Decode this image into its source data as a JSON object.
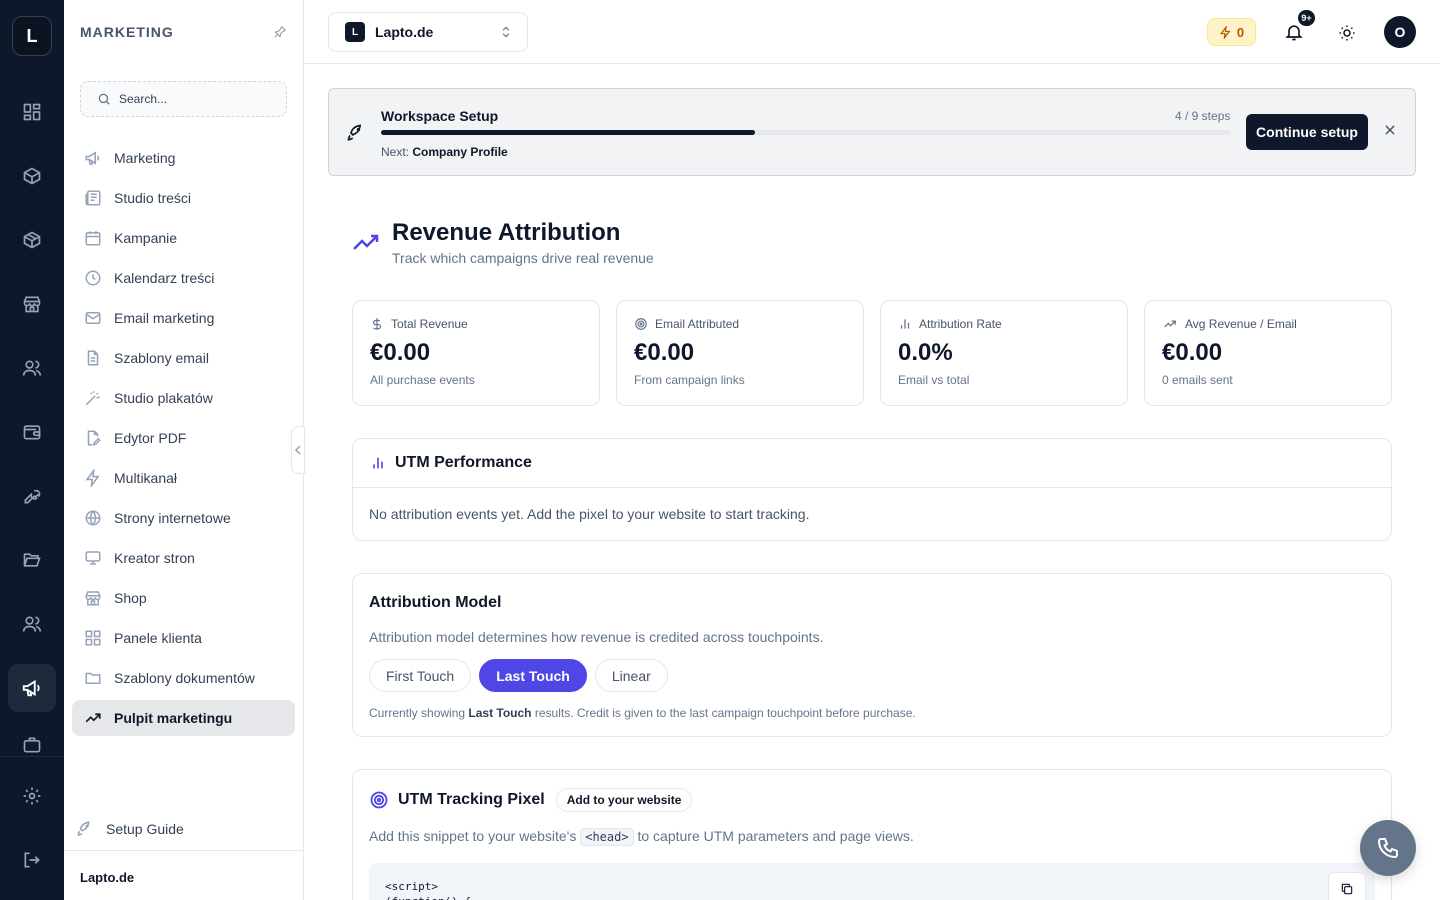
{
  "rail": {
    "logo_letter": "L"
  },
  "sidebar": {
    "title": "MARKETING",
    "search_placeholder": "Search...",
    "items": [
      {
        "label": "Marketing",
        "icon": "megaphone-icon"
      },
      {
        "label": "Studio treści",
        "icon": "newspaper-icon"
      },
      {
        "label": "Kampanie",
        "icon": "calendar-icon"
      },
      {
        "label": "Kalendarz treści",
        "icon": "clock-icon"
      },
      {
        "label": "Email marketing",
        "icon": "mail-icon"
      },
      {
        "label": "Szablony email",
        "icon": "file-text-icon"
      },
      {
        "label": "Studio plakatów",
        "icon": "magic-wand-icon"
      },
      {
        "label": "Edytor PDF",
        "icon": "file-pen-icon"
      },
      {
        "label": "Multikanał",
        "icon": "zap-icon"
      },
      {
        "label": "Strony internetowe",
        "icon": "globe-icon"
      },
      {
        "label": "Kreator stron",
        "icon": "monitor-icon"
      },
      {
        "label": "Shop",
        "icon": "store-icon"
      },
      {
        "label": "Panele klienta",
        "icon": "grid-icon"
      },
      {
        "label": "Szablony dokumentów",
        "icon": "folder-icon"
      },
      {
        "label": "Pulpit marketingu",
        "icon": "trending-up-icon",
        "active": true
      }
    ],
    "setup_guide": "Setup Guide",
    "footer_workspace": "Lapto.de"
  },
  "topbar": {
    "workspace_badge": "L",
    "workspace_name": "Lapto.de",
    "credits": "0",
    "notifications_badge": "9+",
    "avatar_letter": "O"
  },
  "setup": {
    "title": "Workspace Setup",
    "steps": "4 / 9 steps",
    "progress": 0.44,
    "next_label": "Next:",
    "next_value": "Company Profile",
    "button": "Continue setup"
  },
  "page": {
    "title": "Revenue Attribution",
    "subtitle": "Track which campaigns drive real revenue"
  },
  "stats": [
    {
      "label": "Total Revenue",
      "value": "€0.00",
      "sub": "All purchase events",
      "icon": "dollar-icon"
    },
    {
      "label": "Email Attributed",
      "value": "€0.00",
      "sub": "From campaign links",
      "icon": "target-icon"
    },
    {
      "label": "Attribution Rate",
      "value": "0.0%",
      "sub": "Email vs total",
      "icon": "bar-chart-icon"
    },
    {
      "label": "Avg Revenue / Email",
      "value": "€0.00",
      "sub": "0 emails sent",
      "icon": "trending-up-icon"
    }
  ],
  "utm_performance": {
    "title": "UTM Performance",
    "empty": "No attribution events yet. Add the pixel to your website to start tracking."
  },
  "attribution_model": {
    "title": "Attribution Model",
    "description": "Attribution model determines how revenue is credited across touchpoints.",
    "options": [
      "First Touch",
      "Last Touch",
      "Linear"
    ],
    "selected": "Last Touch",
    "note_prefix": "Currently showing",
    "note_bold": "Last Touch",
    "note_suffix": "results. Credit is given to the last campaign touchpoint before purchase."
  },
  "tracking_pixel": {
    "title": "UTM Tracking Pixel",
    "badge": "Add to your website",
    "desc_prefix": "Add this snippet to your website's",
    "desc_code": "<head>",
    "desc_suffix": "to capture UTM parameters and page views.",
    "code": "<script>\n(function() {"
  }
}
